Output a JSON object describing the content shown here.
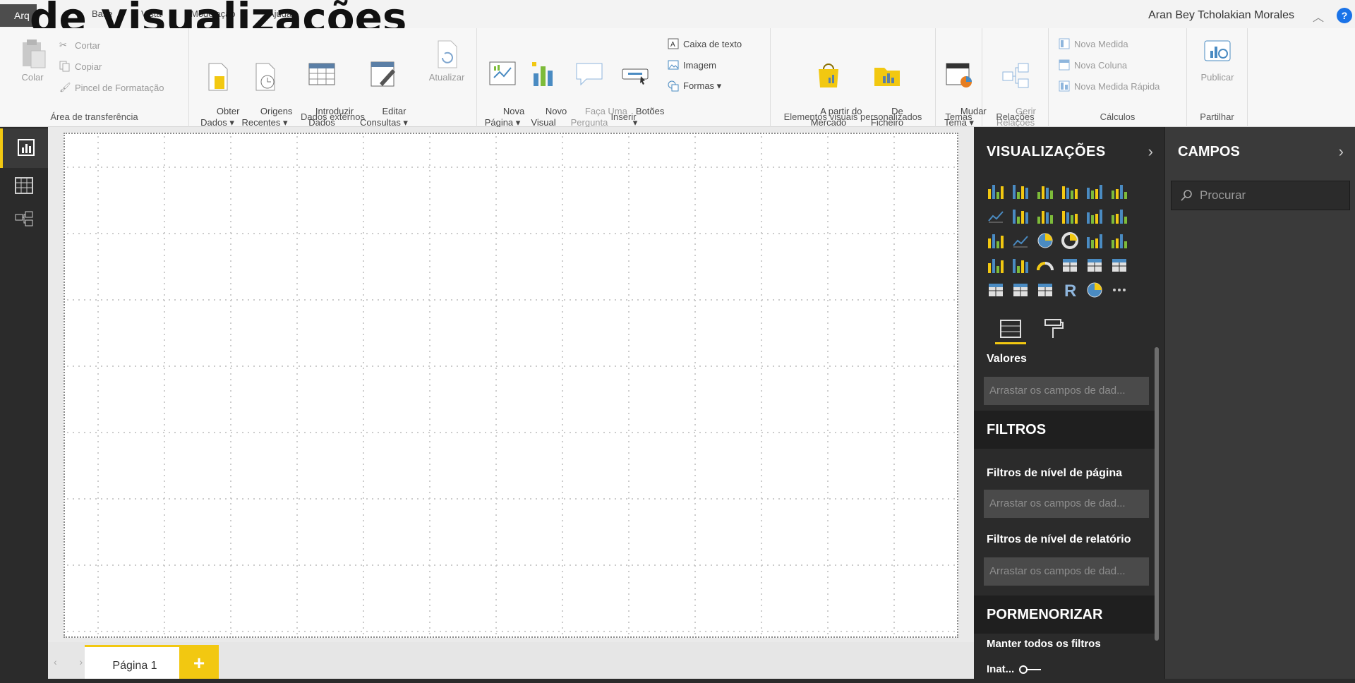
{
  "overlay_title": "de visualizações",
  "menu": {
    "file_tab": "Arq",
    "tabs": [
      "Base",
      "Vista",
      "Modelação",
      "Ajuda"
    ]
  },
  "user": {
    "name": "Aran Bey Tcholakian Morales"
  },
  "ribbon": {
    "clipboard": {
      "label": "Área de transferência",
      "paste": "Colar",
      "cut": "Cortar",
      "copy": "Copiar",
      "format_painter": "Pincel de Formatação"
    },
    "external": {
      "label": "Dados externos",
      "get_data": "Obter\nDados ▾",
      "recent": "Origens\nRecentes ▾",
      "enter_data": "Introduzir\nDados",
      "edit_queries": "Editar\nConsultas ▾",
      "refresh": "Atualizar"
    },
    "insert": {
      "label": "Inserir",
      "new_page": "Nova\nPágina ▾",
      "new_visual": "Novo\nVisual",
      "ask": "Faça Uma\nPergunta",
      "buttons": "Botões\n▾",
      "textbox": "Caixa de texto",
      "image": "Imagem",
      "shapes": "Formas ▾"
    },
    "custom": {
      "label": "Elementos visuais personalizados",
      "marketplace": "A partir do\nMercado",
      "from_file": "De\nFicheiro"
    },
    "themes": {
      "label": "Temas",
      "switch": "Mudar\nTema ▾"
    },
    "relations": {
      "label": "Relações",
      "manage": "Gerir\nRelações"
    },
    "calc": {
      "label": "Cálculos",
      "measure": "Nova Medida",
      "column": "Nova Coluna",
      "quick": "Nova Medida Rápida"
    },
    "share": {
      "label": "Partilhar",
      "publish": "Publicar"
    }
  },
  "canvas": {
    "page_tab": "Página 1",
    "add_page": "+"
  },
  "viz_pane": {
    "title": "VISUALIZAÇÕES",
    "chevron": "›",
    "values_label": "Valores",
    "values_placeholder": "Arrastar os campos de dad...",
    "filters_header": "FILTROS",
    "page_filters_label": "Filtros de nível de página",
    "page_filters_placeholder": "Arrastar os campos de dad...",
    "report_filters_label": "Filtros de nível de relatório",
    "report_filters_placeholder": "Arrastar os campos de dad...",
    "drill_header": "PORMENORIZAR",
    "keep_filters_label": "Manter todos os filtros",
    "toggle_label": "Inat..."
  },
  "fields_pane": {
    "title": "CAMPOS",
    "chevron": "›",
    "search_placeholder": "Procurar"
  },
  "colors": {
    "accent": "#f2c811",
    "dark_pane": "#2b2b2b",
    "ribbon_bg": "#f7f7f7"
  }
}
